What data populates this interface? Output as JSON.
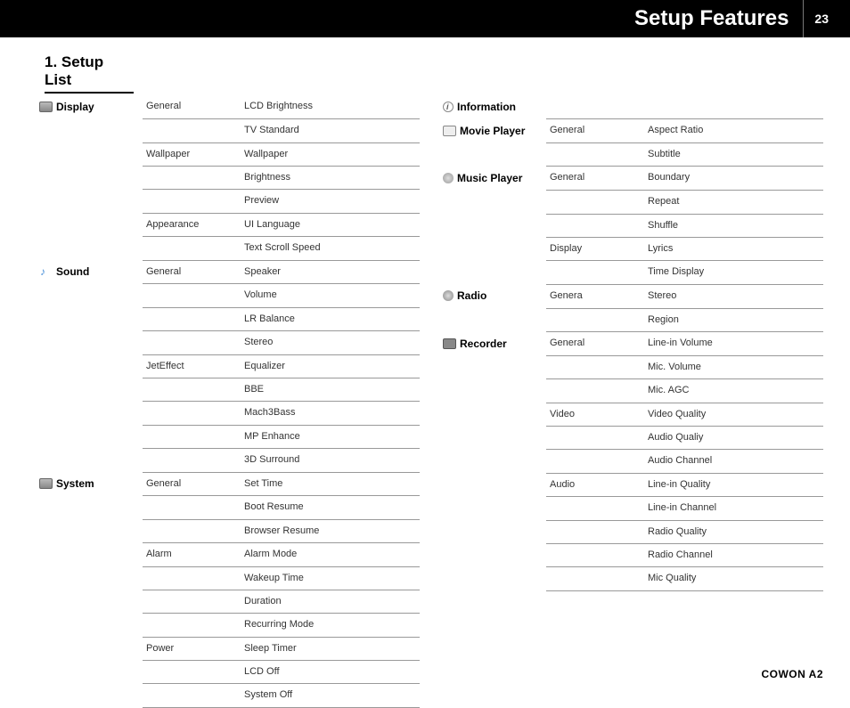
{
  "header": {
    "title": "Setup Features",
    "page": "23"
  },
  "section_title": "1. Setup List",
  "footer": "COWON A2",
  "left": [
    {
      "category": "Display",
      "icon": "display-icon",
      "groups": [
        {
          "group": "General",
          "items": [
            "LCD Brightness",
            "TV Standard"
          ]
        },
        {
          "group": "Wallpaper",
          "items": [
            "Wallpaper",
            "Brightness",
            "Preview"
          ]
        },
        {
          "group": "Appearance",
          "items": [
            "UI Language",
            "Text Scroll Speed"
          ]
        }
      ]
    },
    {
      "category": "Sound",
      "icon": "sound-icon",
      "groups": [
        {
          "group": "General",
          "items": [
            "Speaker",
            "Volume",
            "LR Balance",
            "Stereo"
          ]
        },
        {
          "group": "JetEffect",
          "items": [
            "Equalizer",
            "BBE",
            "Mach3Bass",
            "MP Enhance",
            "3D Surround"
          ]
        }
      ]
    },
    {
      "category": "System",
      "icon": "system-icon",
      "groups": [
        {
          "group": "General",
          "items": [
            "Set Time",
            "Boot Resume",
            "Browser Resume"
          ]
        },
        {
          "group": "Alarm",
          "items": [
            "Alarm Mode",
            "Wakeup Time",
            "Duration",
            "Recurring Mode"
          ]
        },
        {
          "group": "Power",
          "items": [
            "Sleep Timer",
            "LCD Off",
            "System Off"
          ]
        }
      ]
    }
  ],
  "right": [
    {
      "category": "Information",
      "icon": "info-icon",
      "groups": []
    },
    {
      "category": "Movie Player",
      "icon": "movie-icon",
      "groups": [
        {
          "group": "General",
          "items": [
            "Aspect Ratio",
            "Subtitle"
          ]
        }
      ]
    },
    {
      "category": "Music Player",
      "icon": "music-icon",
      "groups": [
        {
          "group": "General",
          "items": [
            "Boundary",
            "Repeat",
            "Shuffle"
          ]
        },
        {
          "group": "Display",
          "items": [
            "Lyrics",
            "Time Display"
          ]
        }
      ]
    },
    {
      "category": "Radio",
      "icon": "radio-icon",
      "groups": [
        {
          "group": "Genera",
          "items": [
            "Stereo",
            "Region"
          ]
        }
      ]
    },
    {
      "category": "Recorder",
      "icon": "recorder-icon",
      "groups": [
        {
          "group": "General",
          "items": [
            "Line-in Volume",
            "Mic. Volume",
            "Mic. AGC"
          ]
        },
        {
          "group": "Video",
          "items": [
            "Video Quality",
            "Audio Qualiy",
            "Audio Channel"
          ]
        },
        {
          "group": "Audio",
          "items": [
            "Line-in Quality",
            "Line-in Channel",
            "Radio Quality",
            "Radio Channel",
            "Mic Quality"
          ]
        }
      ]
    }
  ]
}
